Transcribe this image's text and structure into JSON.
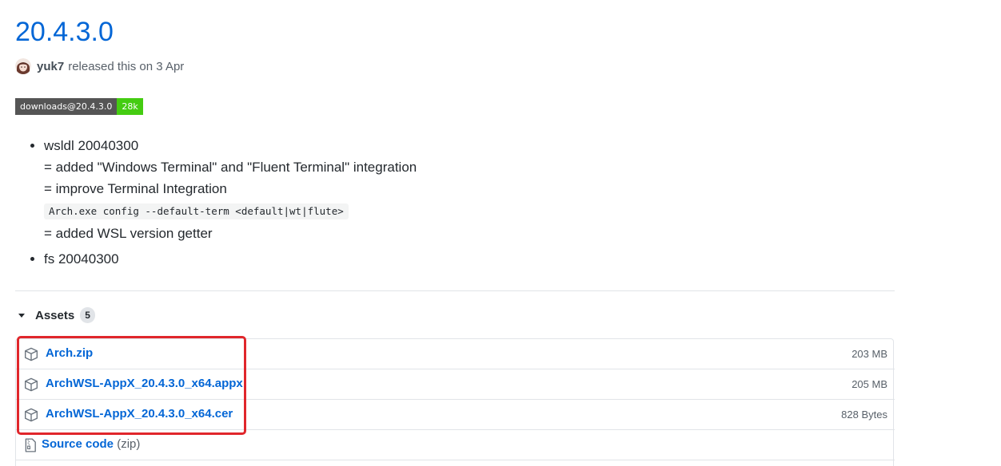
{
  "release": {
    "title": "20.4.3.0",
    "author": "yuk7",
    "released_text": "released this on 3 Apr"
  },
  "badge": {
    "label": "downloads@20.4.3.0",
    "value": "28k"
  },
  "notes": [
    {
      "heading": "wsldl 20040300",
      "lines": [
        "= added \"Windows Terminal\" and \"Fluent Terminal\" integration",
        "= improve Terminal Integration"
      ],
      "code": "Arch.exe config --default-term <default|wt|flute>",
      "after_code": "= added WSL version getter"
    },
    {
      "heading": "fs 20040300"
    }
  ],
  "assets": {
    "label": "Assets",
    "count": "5",
    "items": [
      {
        "name": "Arch.zip",
        "size": "203 MB",
        "icon": "package-icon"
      },
      {
        "name": "ArchWSL-AppX_20.4.3.0_x64.appx",
        "size": "205 MB",
        "icon": "package-icon"
      },
      {
        "name": "ArchWSL-AppX_20.4.3.0_x64.cer",
        "size": "828 Bytes",
        "icon": "package-icon"
      }
    ],
    "source": {
      "name": "Source code",
      "suffix": "(zip)",
      "icon": "file-zip-icon"
    }
  },
  "colors": {
    "link": "#0366d6",
    "highlight": "#e0262b",
    "badge_value": "#44cc11"
  }
}
